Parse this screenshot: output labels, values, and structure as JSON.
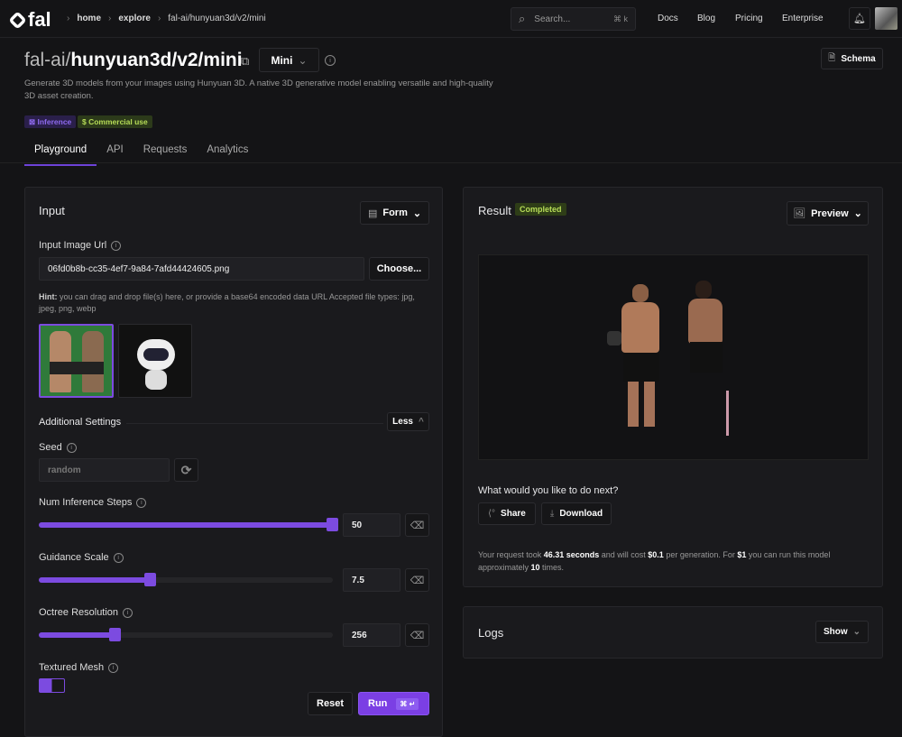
{
  "header": {
    "logo": "fal",
    "breadcrumbs": [
      "home",
      "explore",
      "fal-ai/hunyuan3d/v2/mini"
    ],
    "search_placeholder": "Search...",
    "search_shortcut": "⌘  k",
    "nav": [
      "Docs",
      "Blog",
      "Pricing",
      "Enterprise"
    ]
  },
  "model": {
    "owner": "fal-ai/",
    "name": "hunyuan3d/v2/mini",
    "variant": "Mini",
    "schema_label": "Schema",
    "description": "Generate 3D models from your images using Hunyuan 3D. A native 3D generative model enabling versatile and high-quality 3D asset creation.",
    "badges": [
      {
        "label": "Inference",
        "color": "#7a55e0"
      },
      {
        "label": "Commercial use",
        "color": "#a8d24a"
      }
    ]
  },
  "tabs": [
    "Playground",
    "API",
    "Requests",
    "Analytics"
  ],
  "input": {
    "title": "Input",
    "mode": "Form",
    "image_url_label": "Input Image Url",
    "image_url_value": "06fd0b8b-cc35-4ef7-9a84-7afd44424605.png",
    "choose_label": "Choose...",
    "hint_bold": "Hint:",
    "hint": " you can drag and drop file(s) here, or provide a base64 encoded data URL Accepted file types: jpg, jpeg, png, webp",
    "additional_settings": "Additional Settings",
    "less_label": "Less",
    "seed_label": "Seed",
    "seed_placeholder": "random",
    "sliders": [
      {
        "label": "Num Inference Steps",
        "value": "50",
        "fraction": 1.0
      },
      {
        "label": "Guidance Scale",
        "value": "7.5",
        "fraction": 0.38
      },
      {
        "label": "Octree Resolution",
        "value": "256",
        "fraction": 0.26
      }
    ],
    "textured_mesh_label": "Textured Mesh",
    "textured_mesh_on": true,
    "reset_label": "Reset",
    "run_label": "Run",
    "run_shortcut": "⌘ ↵"
  },
  "result": {
    "title": "Result",
    "status": "Completed",
    "preview_label": "Preview",
    "next_prompt": "What would you like to do next?",
    "share_label": "Share",
    "download_label": "Download",
    "stats": {
      "p1": "Your request took ",
      "time": "46.31 seconds",
      "p2": " and will cost ",
      "cost": "$0.1",
      "p3": " per generation. For ",
      "dollar": "$1",
      "p4": " you can run this model approximately ",
      "times": "10",
      "p5": " times."
    }
  },
  "logs": {
    "title": "Logs",
    "show_label": "Show"
  }
}
